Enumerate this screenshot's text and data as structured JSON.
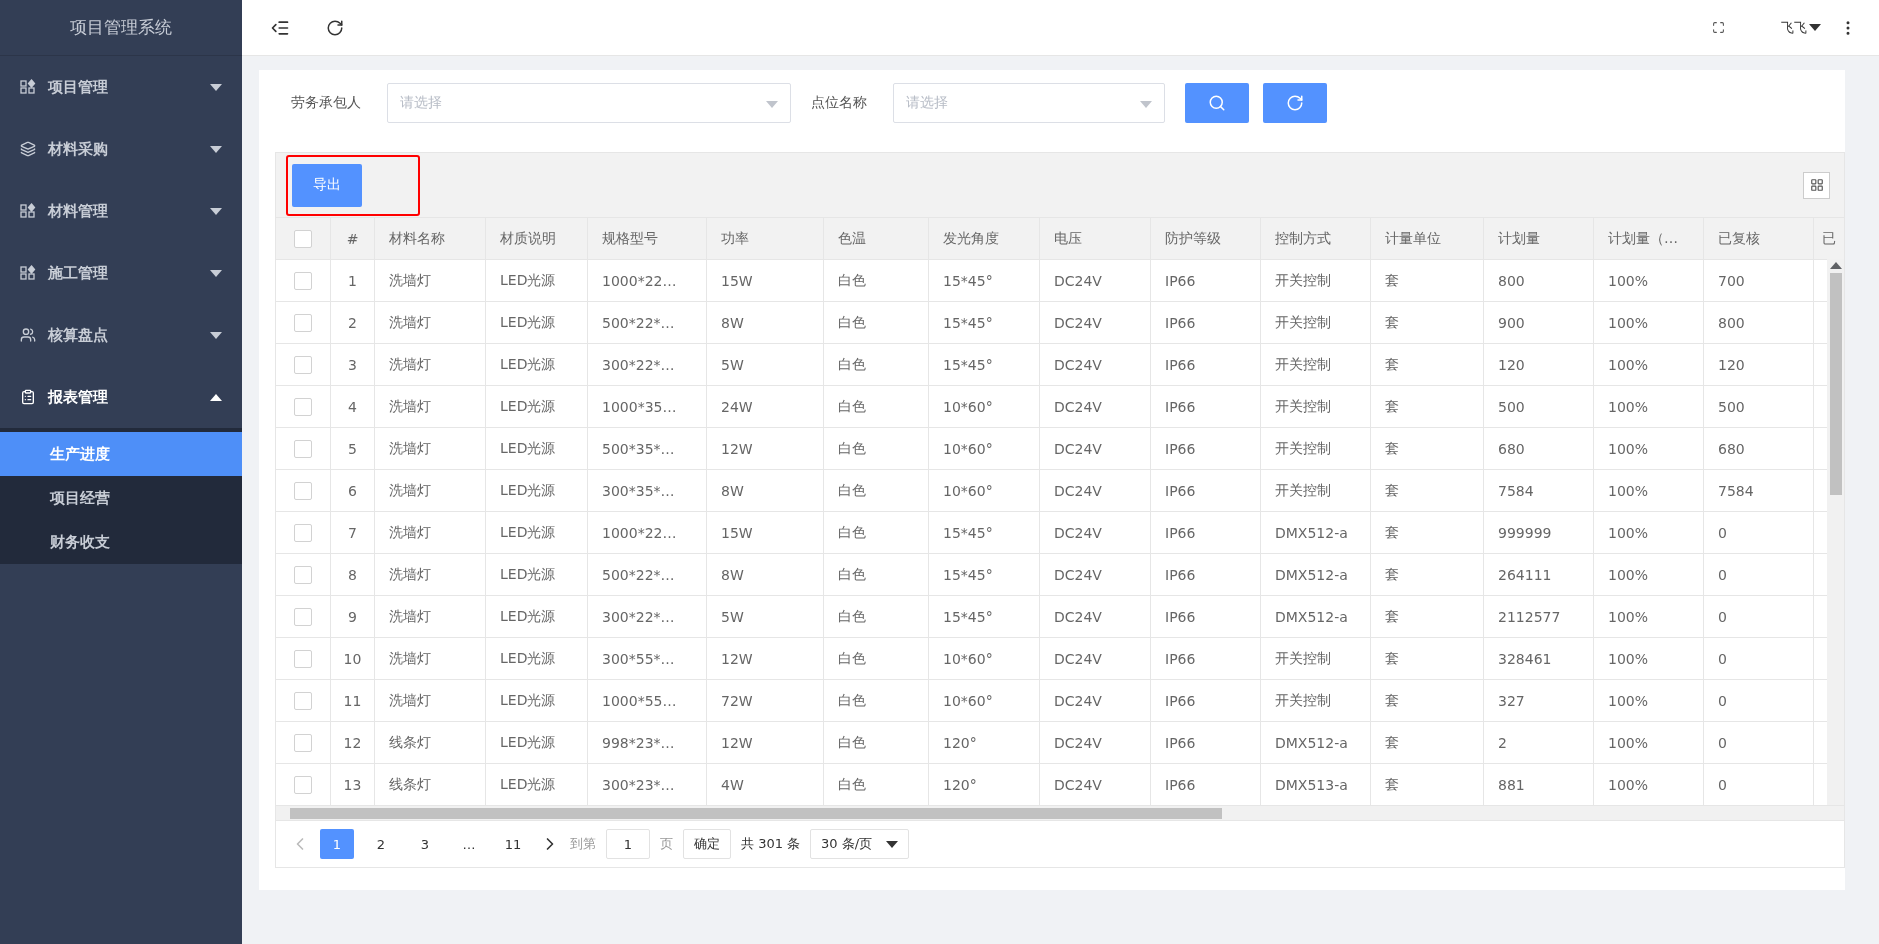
{
  "sidebar": {
    "title": "项目管理系统",
    "menu": [
      {
        "label": "项目管理",
        "expanded": false
      },
      {
        "label": "材料采购",
        "expanded": false
      },
      {
        "label": "材料管理",
        "expanded": false
      },
      {
        "label": "施工管理",
        "expanded": false
      },
      {
        "label": "核算盘点",
        "expanded": false
      },
      {
        "label": "报表管理",
        "expanded": true,
        "children": [
          {
            "label": "生产进度",
            "selected": true
          },
          {
            "label": "项目经营",
            "selected": false
          },
          {
            "label": "财务收支",
            "selected": false
          }
        ]
      }
    ]
  },
  "header": {
    "user": "飞飞"
  },
  "filters": [
    {
      "label": "劳务承包人",
      "placeholder": "请选择"
    },
    {
      "label": "点位名称",
      "placeholder": "请选择"
    }
  ],
  "toolbar": {
    "export_button": "导出",
    "highlighted": true
  },
  "table": {
    "header_checked": false,
    "columns": [
      "#",
      "材料名称",
      "材质说明",
      "规格型号",
      "功率",
      "色温",
      "发光角度",
      "电压",
      "防护等级",
      "控制方式",
      "计量单位",
      "计划量",
      "计划量（…",
      "已复核",
      "已"
    ],
    "rows": [
      {
        "checked": false,
        "cells": [
          "1",
          "洗墙灯",
          "LED光源",
          "1000*22…",
          "15W",
          "白色",
          "15*45°",
          "DC24V",
          "IP66",
          "开关控制",
          "套",
          "800",
          "100%",
          "700"
        ]
      },
      {
        "checked": false,
        "cells": [
          "2",
          "洗墙灯",
          "LED光源",
          "500*22*…",
          "8W",
          "白色",
          "15*45°",
          "DC24V",
          "IP66",
          "开关控制",
          "套",
          "900",
          "100%",
          "800"
        ]
      },
      {
        "checked": false,
        "cells": [
          "3",
          "洗墙灯",
          "LED光源",
          "300*22*…",
          "5W",
          "白色",
          "15*45°",
          "DC24V",
          "IP66",
          "开关控制",
          "套",
          "120",
          "100%",
          "120"
        ]
      },
      {
        "checked": false,
        "cells": [
          "4",
          "洗墙灯",
          "LED光源",
          "1000*35…",
          "24W",
          "白色",
          "10*60°",
          "DC24V",
          "IP66",
          "开关控制",
          "套",
          "500",
          "100%",
          "500"
        ]
      },
      {
        "checked": false,
        "cells": [
          "5",
          "洗墙灯",
          "LED光源",
          "500*35*…",
          "12W",
          "白色",
          "10*60°",
          "DC24V",
          "IP66",
          "开关控制",
          "套",
          "680",
          "100%",
          "680"
        ]
      },
      {
        "checked": false,
        "cells": [
          "6",
          "洗墙灯",
          "LED光源",
          "300*35*…",
          "8W",
          "白色",
          "10*60°",
          "DC24V",
          "IP66",
          "开关控制",
          "套",
          "7584",
          "100%",
          "7584"
        ]
      },
      {
        "checked": false,
        "cells": [
          "7",
          "洗墙灯",
          "LED光源",
          "1000*22…",
          "15W",
          "白色",
          "15*45°",
          "DC24V",
          "IP66",
          "DMX512-a",
          "套",
          "999999",
          "100%",
          "0"
        ]
      },
      {
        "checked": false,
        "cells": [
          "8",
          "洗墙灯",
          "LED光源",
          "500*22*…",
          "8W",
          "白色",
          "15*45°",
          "DC24V",
          "IP66",
          "DMX512-a",
          "套",
          "264111",
          "100%",
          "0"
        ]
      },
      {
        "checked": false,
        "cells": [
          "9",
          "洗墙灯",
          "LED光源",
          "300*22*…",
          "5W",
          "白色",
          "15*45°",
          "DC24V",
          "IP66",
          "DMX512-a",
          "套",
          "2112577",
          "100%",
          "0"
        ]
      },
      {
        "checked": false,
        "cells": [
          "10",
          "洗墙灯",
          "LED光源",
          "300*55*…",
          "12W",
          "白色",
          "10*60°",
          "DC24V",
          "IP66",
          "开关控制",
          "套",
          "328461",
          "100%",
          "0"
        ]
      },
      {
        "checked": false,
        "cells": [
          "11",
          "洗墙灯",
          "LED光源",
          "1000*55…",
          "72W",
          "白色",
          "10*60°",
          "DC24V",
          "IP66",
          "开关控制",
          "套",
          "327",
          "100%",
          "0"
        ]
      },
      {
        "checked": false,
        "cells": [
          "12",
          "线条灯",
          "LED光源",
          "998*23*…",
          "12W",
          "白色",
          "120°",
          "DC24V",
          "IP66",
          "DMX512-a",
          "套",
          "2",
          "100%",
          "0"
        ]
      },
      {
        "checked": false,
        "cells": [
          "13",
          "线条灯",
          "LED光源",
          "300*23*…",
          "4W",
          "白色",
          "120°",
          "DC24V",
          "IP66",
          "DMX513-a",
          "套",
          "881",
          "100%",
          "0"
        ]
      }
    ]
  },
  "pagination": {
    "pages": [
      {
        "label": "1",
        "selected": true
      },
      {
        "label": "2",
        "selected": false
      },
      {
        "label": "3",
        "selected": false
      },
      {
        "label": "…",
        "selected": false
      },
      {
        "label": "11",
        "selected": false
      }
    ],
    "goto_label": "到第",
    "page_input": "1",
    "page_suffix": "页",
    "confirm": "确定",
    "total": "共 301 条",
    "page_size": "30 条/页"
  }
}
